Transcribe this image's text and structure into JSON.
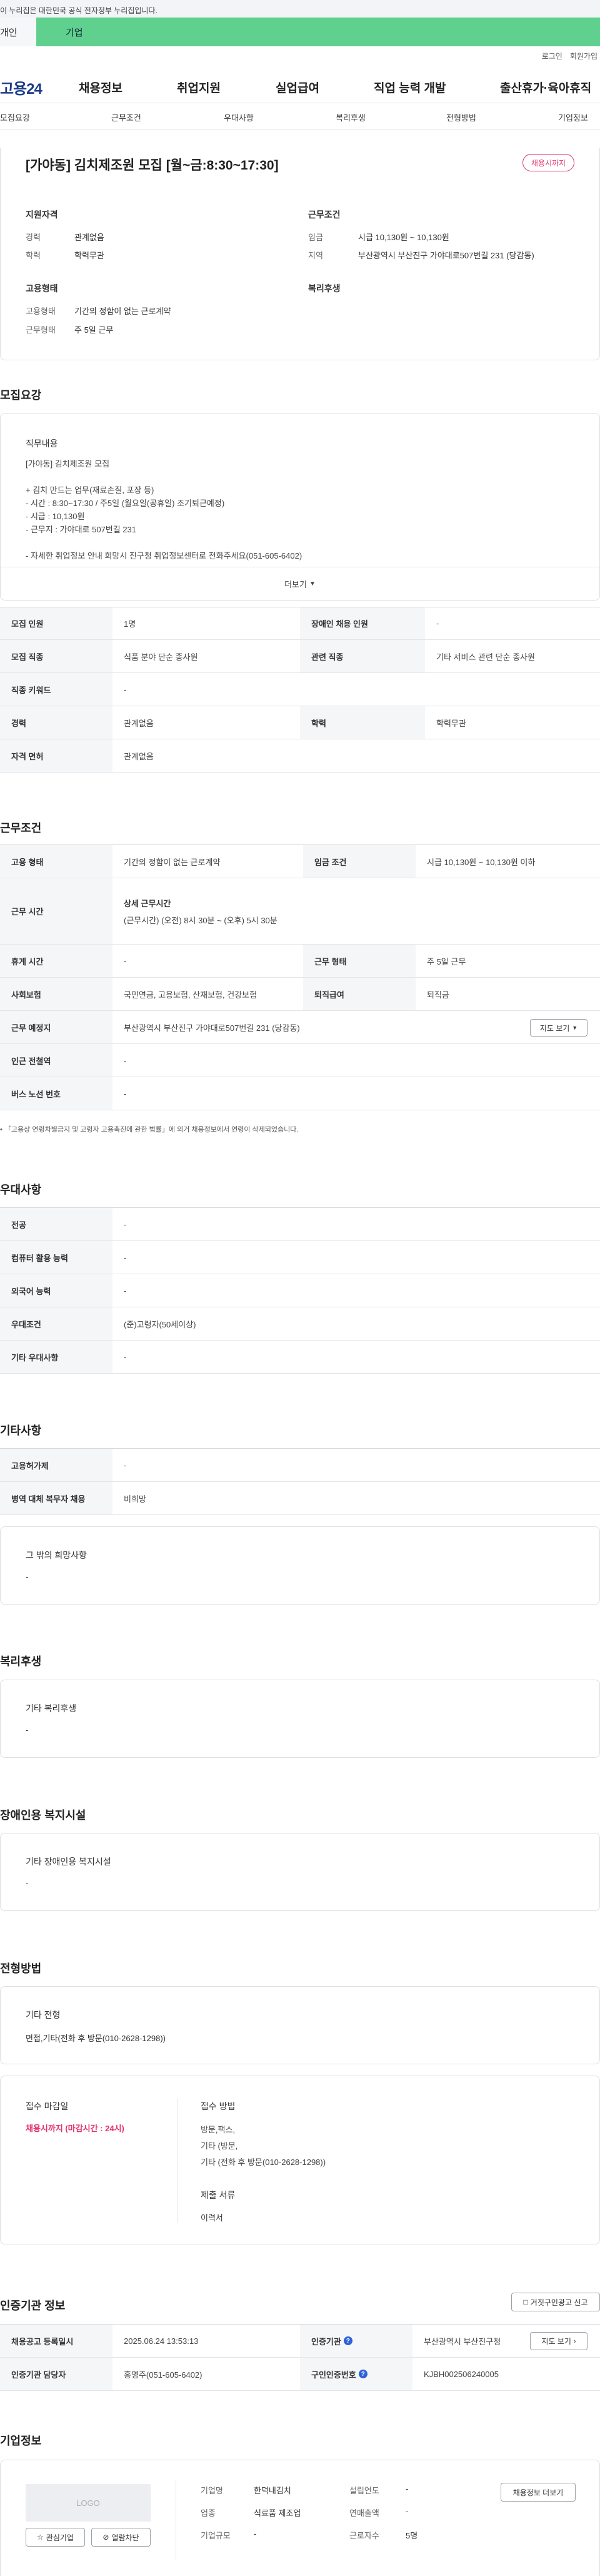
{
  "gov_bar": {
    "text": "이 누리집은 대한민국 공식 전자정부 누리집입니다."
  },
  "user_tabs": {
    "personal": "개인",
    "corporate": "기업"
  },
  "util": {
    "login": "로그인",
    "signup": "회원가입"
  },
  "gnb": {
    "logo": "고용24",
    "items": [
      "채용정보",
      "취업지원",
      "실업급여",
      "직업 능력 개발",
      "출산휴가·육아휴직"
    ]
  },
  "subtabs": [
    "모집요강",
    "근무조건",
    "우대사항",
    "복리후생",
    "전형방법",
    "기업정보"
  ],
  "summary": {
    "title": "[가야동] 김치제조원 모집 [월~금:8:30~17:30]",
    "badge": "채용시까지",
    "qualification": {
      "heading": "지원자격",
      "career_label": "경력",
      "career_value": "관계없음",
      "edu_label": "학력",
      "edu_value": "학력무관"
    },
    "condition": {
      "heading": "근무조건",
      "wage_label": "임금",
      "wage_value": "시급 10,130원 ~ 10,130원",
      "region_label": "지역",
      "region_value": "부산광역시 부산진구 가야대로507번길 231 (당감동)"
    },
    "employment": {
      "heading": "고용형태",
      "type_label": "고용형태",
      "type_value": "기간의 정함이 없는 근로계약",
      "schedule_label": "근무형태",
      "schedule_value": "주 5일 근무"
    },
    "welfare": {
      "heading": "복리후생"
    }
  },
  "recruit": {
    "section_title": "모집요강",
    "job_heading": "직무내용",
    "job_lines": [
      "[가야동] 김치제조원 모집",
      "",
      "+ 김치 만드는 업무(재료손질, 포장 등)",
      "- 시간 : 8:30~17:30 / 주5일 (월요일(공휴일) 조기퇴근예정)",
      "- 시급 : 10,130원",
      "- 근무지 : 가야대로 507번길 231",
      "",
      "- 자세한 취업정보 안내 희망시 진구청 취업정보센터로 전화주세요(051-605-6402)"
    ],
    "more": "더보기",
    "table": [
      {
        "l1": "모집 인원",
        "v1": "1명",
        "l2": "장애인 채용 인원",
        "v2": "-"
      },
      {
        "l1": "모집 직종",
        "v1": "식품 분야 단순 종사원",
        "l2": "관련 직종",
        "v2": "기타 서비스 관련 단순 종사원"
      },
      {
        "l1": "직종 키워드",
        "v1": "-"
      },
      {
        "l1": "경력",
        "v1": "관계없음",
        "l2": "학력",
        "v2": "학력무관"
      },
      {
        "l1": "자격 면허",
        "v1": "관계없음"
      }
    ]
  },
  "work": {
    "section_title": "근무조건",
    "row1": {
      "l1": "고용 형태",
      "v1": "기간의 정함이 없는 근로계약",
      "l2": "임금 조건",
      "v2": "시급 10,130원 ~ 10,130원 이하"
    },
    "row2": {
      "l1": "근무 시간",
      "v_title": "상세 근무시간",
      "v_detail": "(근무시간) (오전) 8시 30분 ~ (오후) 5시 30분"
    },
    "row3": {
      "l1": "휴게 시간",
      "v1": "-",
      "l2": "근무 형태",
      "v2": "주 5일 근무"
    },
    "row4": {
      "l1": "사회보험",
      "v1": "국민연금, 고용보험, 산재보험, 건강보험",
      "l2": "퇴직급여",
      "v2": "퇴직금"
    },
    "row5": {
      "l1": "근무 예정지",
      "v1": "부산광역시 부산진구 가야대로507번길 231 (당감동)",
      "map_btn": "지도 보기"
    },
    "row6": {
      "l1": "인근 전철역",
      "v1": "-"
    },
    "row7": {
      "l1": "버스 노선 번호",
      "v1": "-"
    },
    "note": "「고용상 연령차별금지 및 고령자 고용촉진에 관한 법률」에 의거 채용정보에서 연령이 삭제되었습니다."
  },
  "pref": {
    "section_title": "우대사항",
    "rows": [
      {
        "l": "전공",
        "v": "-"
      },
      {
        "l": "컴퓨터 활용 능력",
        "v": "-"
      },
      {
        "l": "외국어 능력",
        "v": "-"
      },
      {
        "l": "우대조건",
        "v": "(준)고령자(50세이상)"
      },
      {
        "l": "기타 우대사항",
        "v": "-"
      }
    ]
  },
  "etc": {
    "section_title": "기타사항",
    "rows": [
      {
        "l": "고용허가제",
        "v": "-"
      },
      {
        "l": "병역 대체 복무자 채용",
        "v": "비희망"
      }
    ],
    "box_heading": "그 밖의 희망사항",
    "box_value": "-"
  },
  "benefit": {
    "section_title": "복리후생",
    "box_heading": "기타 복리후생",
    "box_value": "-"
  },
  "disabled": {
    "section_title": "장애인용 복지시설",
    "box_heading": "기타 장애인용 복지시설",
    "box_value": "-"
  },
  "selection": {
    "section_title": "전형방법",
    "box_heading": "기타 전형",
    "box_value": "면접,기타(전화 후 방문(010-2628-1298))",
    "deadline_heading": "접수 마감일",
    "deadline_value": "채용시까지 (마감시간 : 24시)",
    "method_heading": "접수 방법",
    "method_lines": [
      "방문,팩스,",
      "기타 (방문,",
      "기타 (전화 후 방문(010-2628-1298))"
    ],
    "docs_heading": "제출 서류",
    "docs_value": "이력서"
  },
  "cert": {
    "section_title": "인증기관 정보",
    "report_btn": "거짓구인광고 신고",
    "row1": {
      "l1": "채용공고 등록일시",
      "v1": "2025.06.24 13:53:13",
      "l2": "인증기관",
      "v2": "부산광역시 부산진구청",
      "btn": "지도 보기"
    },
    "row2": {
      "l1": "인증기관 담당자",
      "v1": "홍영주(051-605-6402)",
      "l2": "구인인증번호",
      "v2": "KJBH002506240005"
    }
  },
  "company": {
    "section_title": "기업정보",
    "logo": "LOGO",
    "fav_btn": "관심기업",
    "block_btn": "열람차단",
    "name_l": "기업명",
    "name_v": "한덕내김치",
    "industry_l": "업종",
    "industry_v": "식료품 제조업",
    "size_l": "기업규모",
    "size_v": "-",
    "founded_l": "설립연도",
    "founded_v": "-",
    "sales_l": "연매출액",
    "sales_v": "-",
    "workers_l": "근로자수",
    "workers_v": "5명",
    "list_btn": "채용정보 더보기"
  }
}
